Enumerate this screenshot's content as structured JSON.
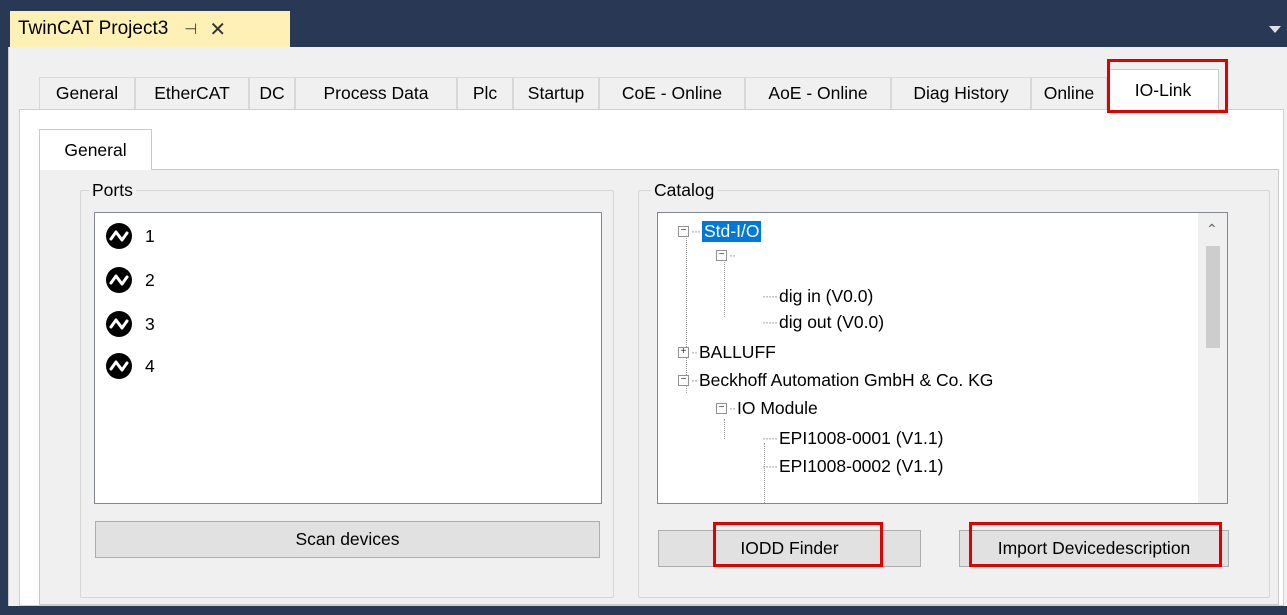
{
  "document": {
    "tab_title": "TwinCAT Project3",
    "pin_glyph": "⊣",
    "close_glyph": "✕"
  },
  "tabs": [
    "General",
    "EtherCAT",
    "DC",
    "Process Data",
    "Plc",
    "Startup",
    "CoE - Online",
    "AoE - Online",
    "Diag History",
    "Online",
    "IO-Link"
  ],
  "active_tab": "IO-Link",
  "inner_tab": "General",
  "ports": {
    "label": "Ports",
    "items": [
      "1",
      "2",
      "3",
      "4"
    ],
    "scan_button": "Scan devices"
  },
  "catalog": {
    "label": "Catalog",
    "tree": {
      "std_io": "Std-I/O",
      "dig_in": "dig in (V0.0)",
      "dig_out": "dig out (V0.0)",
      "balluff": "BALLUFF",
      "beckhoff": "Beckhoff Automation GmbH & Co. KG",
      "io_module": "IO Module",
      "epi1": "EPI1008-0001 (V1.1)",
      "epi2": "EPI1008-0002 (V1.1)"
    },
    "iodd_button": "IODD Finder",
    "import_button": "Import Devicedescription"
  },
  "colors": {
    "highlight": "#e00000",
    "selection": "#0078d7",
    "doc_tab": "#fff1b5",
    "frame": "#293955"
  },
  "icons": {
    "port": "io-link-port-icon",
    "expand_minus": "collapse-icon",
    "expand_plus": "expand-icon",
    "scroll_up": "scroll-up-icon"
  }
}
